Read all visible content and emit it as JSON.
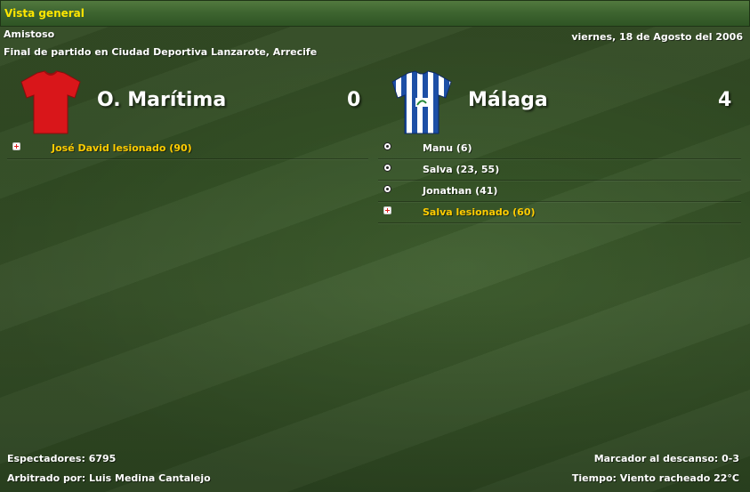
{
  "window": {
    "title": "Vista general"
  },
  "match": {
    "competition": "Amistoso",
    "date": "viernes, 18 de Agosto del 2006",
    "venue_line": "Final de partido en Ciudad Deportiva Lanzarote, Arrecife"
  },
  "home": {
    "name": "O. Marítima",
    "score": "0",
    "shirt_icon": "red-shirt-icon",
    "color": "#d9161a",
    "events": [
      {
        "type": "injury",
        "text": "José David lesionado (90)"
      }
    ]
  },
  "away": {
    "name": "Málaga",
    "score": "4",
    "shirt_icon": "blue-white-striped-shirt-icon",
    "color": "#1d4fa6",
    "events": [
      {
        "type": "goal",
        "text": "Manu (6)"
      },
      {
        "type": "goal",
        "text": "Salva (23, 55)"
      },
      {
        "type": "goal",
        "text": "Jonathan (41)"
      },
      {
        "type": "injury",
        "text": "Salva lesionado (60)"
      }
    ]
  },
  "footer": {
    "attendance": "Espectadores: 6795",
    "referee": "Arbitrado por: Luis Medina Cantalejo",
    "halftime": "Marcador al descanso: 0-3",
    "weather": "Tiempo: Viento racheado 22°C"
  },
  "colors": {
    "title_text": "#ffe600",
    "injury_text": "#ffcc00"
  }
}
